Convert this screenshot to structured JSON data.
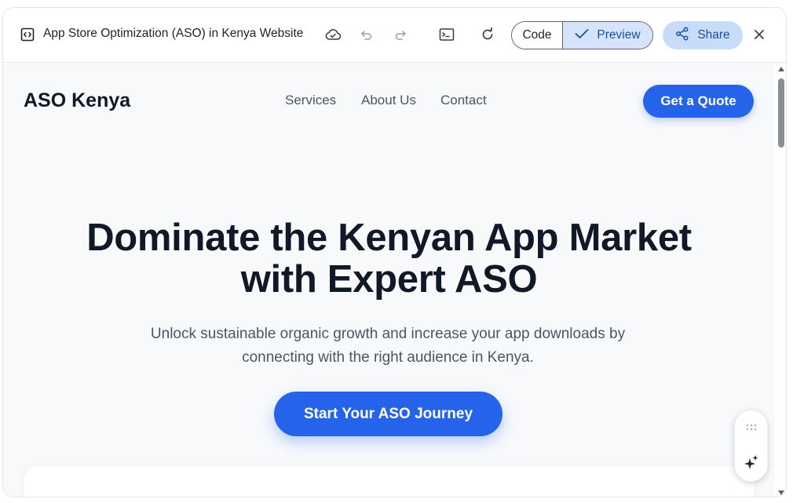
{
  "toolbar": {
    "title": "App Store Optimization (ASO) in Kenya Website",
    "code_label": "Code",
    "preview_label": "Preview",
    "share_label": "Share"
  },
  "site": {
    "brand": "ASO Kenya",
    "nav": [
      "Services",
      "About Us",
      "Contact"
    ],
    "quote_button": "Get a Quote",
    "hero_title_line1": "Dominate the Kenyan App Market",
    "hero_title_line2": "with Expert ASO",
    "hero_sub_line1": "Unlock sustainable organic growth and increase your app downloads by",
    "hero_sub_line2": "connecting with the right audience in Kenya.",
    "cta_button": "Start Your ASO Journey"
  },
  "icons": {
    "document": "code-document-icon",
    "cloud": "cloud-icon",
    "undo": "undo-icon",
    "redo": "redo-icon",
    "terminal": "terminal-icon",
    "refresh": "refresh-icon",
    "check": "check-icon",
    "share": "share-icon",
    "close": "close-icon",
    "drag": "drag-handle-icon",
    "sparkle": "sparkle-icon"
  },
  "colors": {
    "accent": "#2563eb",
    "preview_bg": "#f8f9fb",
    "toggle_active": "#d6e4fb",
    "share_bg": "#c7dcf9"
  }
}
